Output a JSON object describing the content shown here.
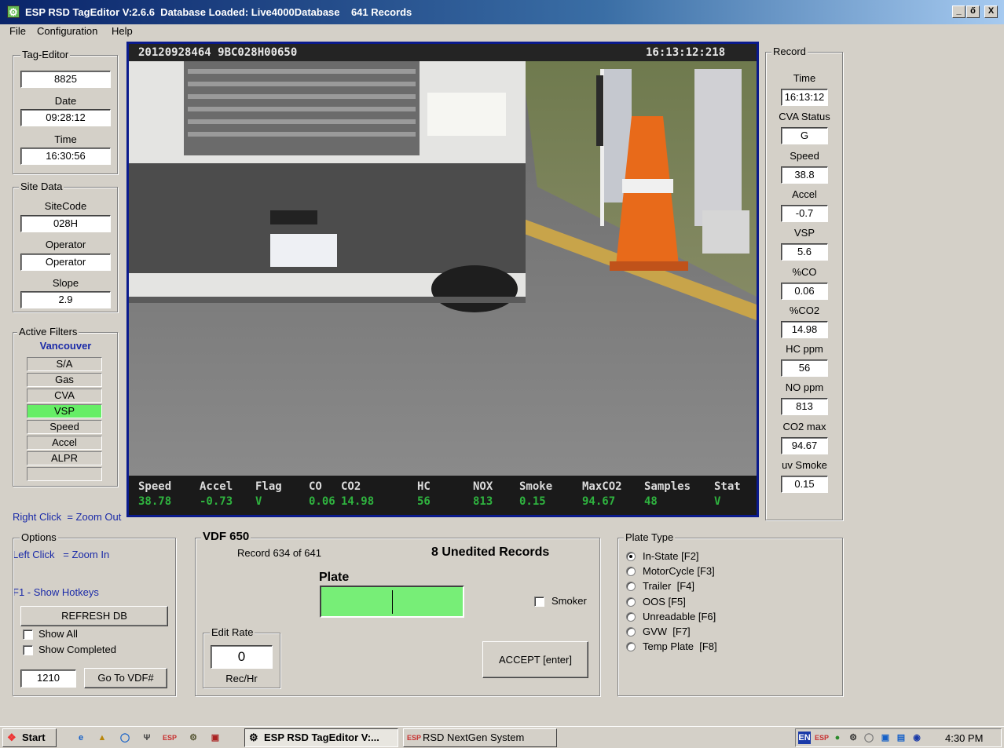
{
  "window": {
    "title": "ESP RSD TagEditor V:2.6.6  Database Loaded: Live4000Database    641 Records",
    "controls": [
      "_",
      "ő",
      "X"
    ]
  },
  "menu": [
    "File",
    "Configuration",
    "Help"
  ],
  "tag_editor": {
    "group_label": "Tag-Editor",
    "id_value": "8825",
    "date_label": "Date",
    "date_value": "09:28:12",
    "time_label": "Time",
    "time_value": "16:30:56"
  },
  "site_data": {
    "group_label": "Site Data",
    "sitecode_label": "SiteCode",
    "sitecode_value": "028H",
    "operator_label": "Operator",
    "operator_value": "Operator",
    "slope_label": "Slope",
    "slope_value": "2.9"
  },
  "filters": {
    "group_label": "Active Filters",
    "region": "Vancouver",
    "items": [
      {
        "label": "S/A",
        "active": false
      },
      {
        "label": "Gas",
        "active": false
      },
      {
        "label": "CVA",
        "active": false
      },
      {
        "label": "VSP",
        "active": true
      },
      {
        "label": "Speed",
        "active": false
      },
      {
        "label": "Accel",
        "active": false
      },
      {
        "label": "ALPR",
        "active": false
      },
      {
        "label": "",
        "active": false
      }
    ],
    "active_color": "#66ee66"
  },
  "hints": [
    "Right Click  = Zoom Out",
    "Left Click   = Zoom In",
    "F1 - Show Hotkeys"
  ],
  "video": {
    "record_id": "20120928464 9BC028H00650",
    "timestamp": "16:13:12:218",
    "stats": {
      "headers": [
        "Speed",
        "Accel",
        "Flag",
        "CO",
        "CO2",
        "HC",
        "NOX",
        "Smoke",
        "MaxCO2",
        "Samples",
        "Stat"
      ],
      "values": [
        "38.78",
        "-0.73",
        "V",
        "0.06",
        "14.98",
        "56",
        "813",
        "0.15",
        "94.67",
        "48",
        "V"
      ]
    }
  },
  "record": {
    "group_label": "Record",
    "fields": [
      {
        "label": "Time",
        "value": "16:13:12"
      },
      {
        "label": "CVA Status",
        "value": "G"
      },
      {
        "label": "Speed",
        "value": "38.8"
      },
      {
        "label": "Accel",
        "value": "-0.7"
      },
      {
        "label": "VSP",
        "value": "5.6"
      },
      {
        "label": "%CO",
        "value": "0.06"
      },
      {
        "label": "%CO2",
        "value": "14.98"
      },
      {
        "label": "HC ppm",
        "value": "56"
      },
      {
        "label": "NO ppm",
        "value": "813"
      },
      {
        "label": "CO2 max",
        "value": "94.67"
      },
      {
        "label": "uv Smoke",
        "value": "0.15"
      }
    ]
  },
  "options": {
    "group_label": "Options",
    "refresh_label": "REFRESH DB",
    "show_all_label": "Show All",
    "show_completed_label": "Show Completed",
    "vdf_input": "1210",
    "goto_label": "Go To VDF#"
  },
  "vdf": {
    "title": "VDF 650",
    "record_text": "Record 634 of 641",
    "unedited_text": "8 Unedited Records",
    "plate_label": "Plate",
    "plate_color": "#77ee77",
    "smoker_label": "Smoker",
    "edit_rate_label": "Edit Rate",
    "edit_rate_value": "0",
    "rate_unit": "Rec/Hr",
    "accept_label": "ACCEPT [enter]"
  },
  "plate_type": {
    "group_label": "Plate Type",
    "options": [
      {
        "label": "In-State [F2]",
        "selected": true
      },
      {
        "label": "MotorCycle [F3]",
        "selected": false
      },
      {
        "label": "Trailer  [F4]",
        "selected": false
      },
      {
        "label": "OOS [F5]",
        "selected": false
      },
      {
        "label": "Unreadable [F6]",
        "selected": false
      },
      {
        "label": "GVW  [F7]",
        "selected": false
      },
      {
        "label": "Temp Plate  [F8]",
        "selected": false
      }
    ]
  },
  "taskbar": {
    "start_label": "Start",
    "tasks": [
      "ESP RSD TagEditor V:...",
      "RSD NextGen System"
    ],
    "lang": "EN",
    "clock": "4:30 PM"
  }
}
